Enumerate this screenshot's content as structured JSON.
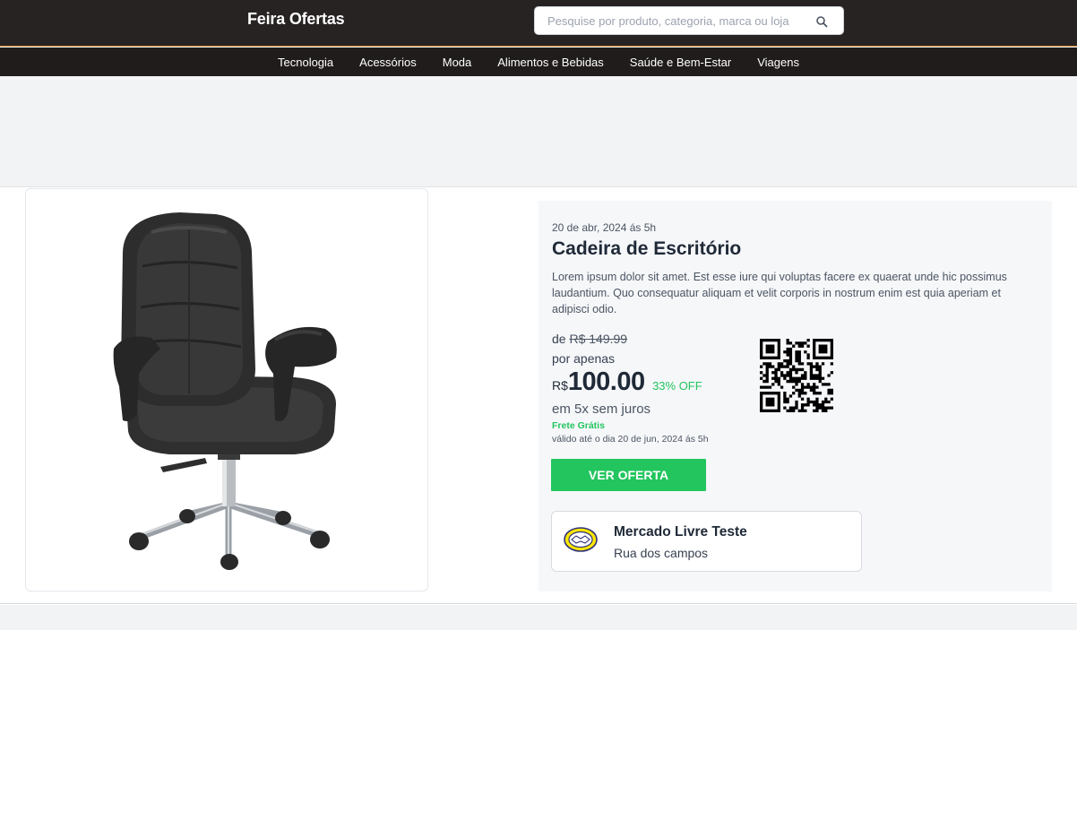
{
  "header": {
    "brand": "Feira Ofertas",
    "search_placeholder": "Pesquise por produto, categoria, marca ou loja"
  },
  "categories": [
    "Tecnologia",
    "Acessórios",
    "Moda",
    "Alimentos e Bebidas",
    "Saúde e Bem-Estar",
    "Viagens"
  ],
  "product": {
    "date": "20 de abr, 2024 ás 5h",
    "title": "Cadeira de Escritório",
    "description": "Lorem ipsum dolor sit amet. Est esse iure qui voluptas facere ex quaerat unde hic possimus laudantium. Quo consequatur aliquam et velit corporis in nostrum enim est quia aperiam et adipisci odio.",
    "from_label": "de",
    "old_price": "R$ 149.99",
    "por_label": "por apenas",
    "currency": "R$",
    "price": "100.00",
    "discount": "33% OFF",
    "installments": "em 5x sem juros",
    "shipping": "Frete Grátis",
    "valid_until": "válido até o dia 20 de jun, 2024 ás 5h",
    "cta": "VER OFERTA"
  },
  "store": {
    "name": "Mercado Livre Teste",
    "address": "Rua dos campos",
    "logo": "mercado-livre-handshake-logo"
  },
  "icons": {
    "search": "search-icon",
    "qr": "qr-code-icon"
  },
  "colors": {
    "header_bg": "#262322",
    "accent_green": "#22c55e",
    "nav_border": "#d9822b"
  }
}
